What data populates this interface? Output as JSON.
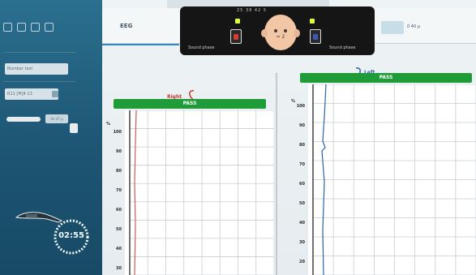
{
  "app": {
    "tab": "EEG",
    "status_title": "25 38 42 5"
  },
  "probe_status": {
    "right_label": "Sound phase",
    "left_label": "Sound phase",
    "right_color": "#d33c2f",
    "left_color": "#3f58b8",
    "face_badge": "= 2"
  },
  "top_right": {
    "label": "0 40 µ"
  },
  "sidebar": {
    "field_1": "Number test",
    "field_2": "R11 [M]4 13",
    "slider_value": "Hz 47 µ",
    "timer": "02:55"
  },
  "panels": {
    "right": {
      "title": "Right",
      "result": "PASS",
      "y_unit": "%",
      "y_ticks": [
        "100",
        "90",
        "80",
        "70",
        "60",
        "50",
        "40",
        "30"
      ],
      "trace_color": "#d05a5a"
    },
    "left": {
      "title": "Left",
      "result": "PASS",
      "y_unit": "%",
      "y_ticks": [
        "100",
        "90",
        "80",
        "70",
        "60",
        "50",
        "40",
        "30",
        "20"
      ],
      "trace_color": "#2a63a9"
    }
  },
  "colors": {
    "pass_green": "#1f9b3a",
    "sidebar_blue": "#1f5c7c",
    "right_ear_red": "#c73a2c",
    "left_ear_blue": "#2a63a9"
  }
}
